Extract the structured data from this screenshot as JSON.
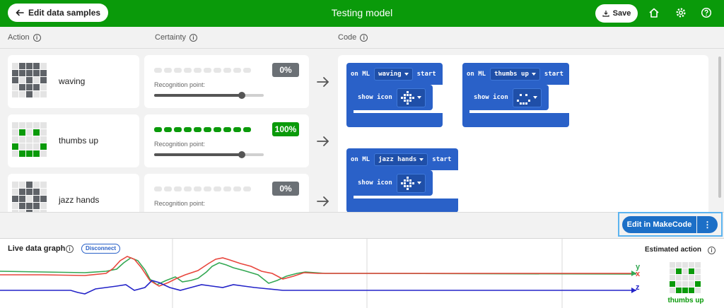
{
  "header": {
    "back_label": "Edit data samples",
    "title": "Testing model",
    "save_label": "Save",
    "bg_color": "#0a9a0a"
  },
  "columns": {
    "action": "Action",
    "certainty": "Certainty",
    "code": "Code"
  },
  "actions": [
    {
      "name": "waving",
      "certainty": "0%",
      "certainty_value": 0,
      "recognition_label": "Recognition point:",
      "recognition_point": 0.8
    },
    {
      "name": "thumbs up",
      "certainty": "100%",
      "certainty_value": 1,
      "recognition_label": "Recognition point:",
      "recognition_point": 0.8
    },
    {
      "name": "jazz hands",
      "certainty": "0%",
      "certainty_value": 0,
      "recognition_label": "Recognition point:",
      "recognition_point": 0.8
    }
  ],
  "code_blocks": [
    {
      "event": "on ML",
      "action": "waving",
      "start": "start",
      "show": "show icon"
    },
    {
      "event": "on ML",
      "action": "thumbs up",
      "start": "start",
      "show": "show icon"
    },
    {
      "event": "on ML",
      "action": "jazz hands",
      "start": "start",
      "show": "show icon"
    }
  ],
  "makecode": {
    "label": "Edit in MakeCode",
    "more": "⋮"
  },
  "live": {
    "title": "Live data graph",
    "disconnect": "Disconnect",
    "axes": [
      "y",
      "x",
      "z"
    ],
    "colors": {
      "x": "#e8453c",
      "y": "#34a853",
      "z": "#2323c8"
    }
  },
  "estimated": {
    "title": "Estimated action",
    "action": "thumbs up"
  }
}
